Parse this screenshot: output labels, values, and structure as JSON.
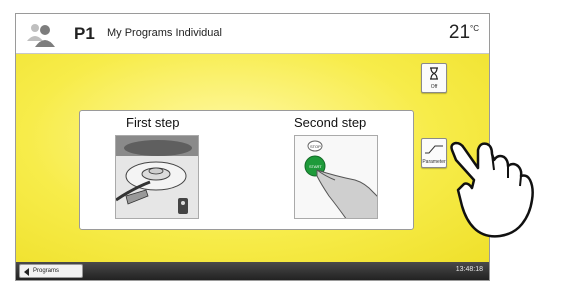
{
  "header": {
    "program_number": "P1",
    "program_name": "My Programs Individual",
    "temperature_value": "21",
    "temperature_unit": "°C"
  },
  "side_buttons": {
    "timer_label": "Off",
    "parameter_label": "Parameter"
  },
  "dialog": {
    "first_step_title": "First step",
    "second_step_title": "Second step",
    "stop_label": "STOP",
    "start_label": "START"
  },
  "footer": {
    "back_label": "Programs",
    "time": "13:48:18"
  },
  "colors": {
    "accent_yellow": "#f7ec4a",
    "start_green": "#1e9a3a",
    "footer_dark": "#2a2a2a"
  }
}
